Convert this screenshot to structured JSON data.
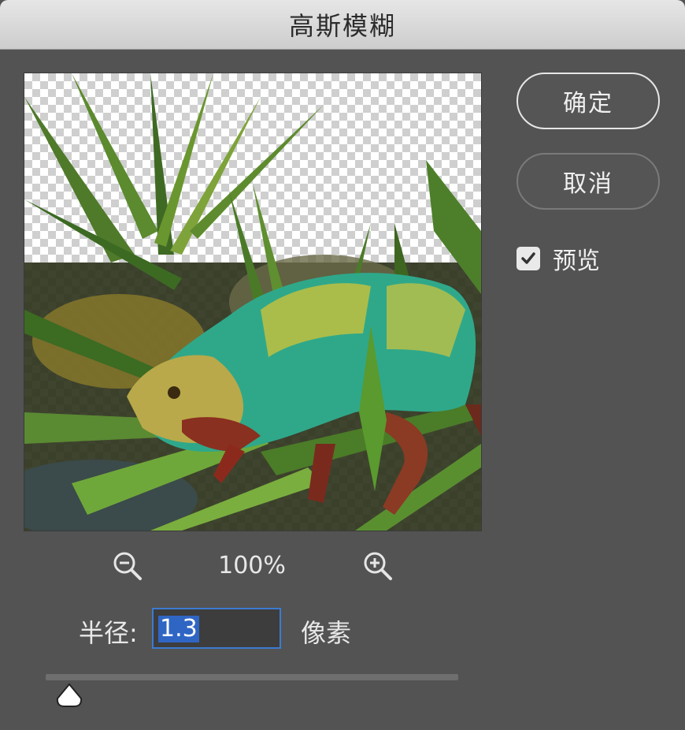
{
  "window": {
    "title": "高斯模糊"
  },
  "buttons": {
    "ok_label": "确定",
    "cancel_label": "取消"
  },
  "preview_toggle": {
    "label": "预览",
    "checked": true
  },
  "zoom": {
    "value": "100%"
  },
  "radius": {
    "label": "半径:",
    "value": "1.3",
    "unit": "像素"
  },
  "slider": {
    "value": 1.3
  },
  "colors": {
    "background": "#535353",
    "selection": "#2f66c4",
    "input_border": "#3c7bd1"
  },
  "icons": {
    "zoom_out": "zoom-out-icon",
    "zoom_in": "zoom-in-icon",
    "check": "checkmark-icon"
  }
}
